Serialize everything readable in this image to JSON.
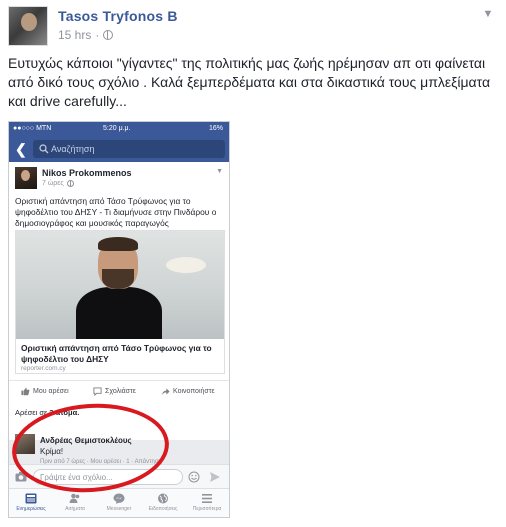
{
  "post": {
    "author": "Tasos Tryfonos B",
    "time": "15 hrs",
    "separator": "·",
    "text": "Ευτυχώς κάποιοι \"γίγαντες\" της πολιτικής μας ζωής ηρέμησαν απ οτι φαίνεται από δικό τους σχόλιο . Καλά ξεμπερδέματα και στα δικαστικά τους μπλεξίματα και drive carefully..."
  },
  "phone": {
    "status": {
      "carrier": "●●○○○ MTN",
      "time": "5:20 μ.μ.",
      "battery": "16%"
    },
    "search_placeholder": "Αναζήτηση",
    "card": {
      "author": "Nikos Prokommenos",
      "time": "7 ώρες",
      "text": "Οριστική απάντηση από Τάσο Τρύφωνος για το ψηφοδέλτιο του ΔΗΣΥ - Τι διαμήνυσε στην Πινδάρου ο δημοσιογράφος και μουσικός παραγωγός",
      "link_title": "Οριστική απάντηση από Τάσο Τρύφωνος για το ψηφοδέλτιο του ΔΗΣΥ",
      "link_domain": "reporter.com.cy",
      "actions": {
        "like": "Μου αρέσει",
        "comment": "Σχολιάστε",
        "share": "Κοινοποιήστε"
      },
      "likes_prefix": "Αρέσει σε",
      "likes_count": "3 άτομα."
    },
    "comment": {
      "author": "Ανδρέας Θεμιστοκλέους",
      "text": "Κρίμα!",
      "meta": "Πριν από 7 ώρες · Μου αρέσει · 1 · Απάντηση"
    },
    "composer_placeholder": "Γράψτε ένα σχόλιο...",
    "tabs": [
      {
        "label": "Ενημερώσεις",
        "icon": "news-feed-icon"
      },
      {
        "label": "Αιτήματα",
        "icon": "friend-requests-icon"
      },
      {
        "label": "Messenger",
        "icon": "messenger-icon"
      },
      {
        "label": "Ειδοποιήσεις",
        "icon": "globe-icon"
      },
      {
        "label": "Περισσότερα",
        "icon": "menu-icon"
      }
    ]
  },
  "colors": {
    "fb_blue": "#3b5998",
    "annotation_red": "#d8191f"
  }
}
